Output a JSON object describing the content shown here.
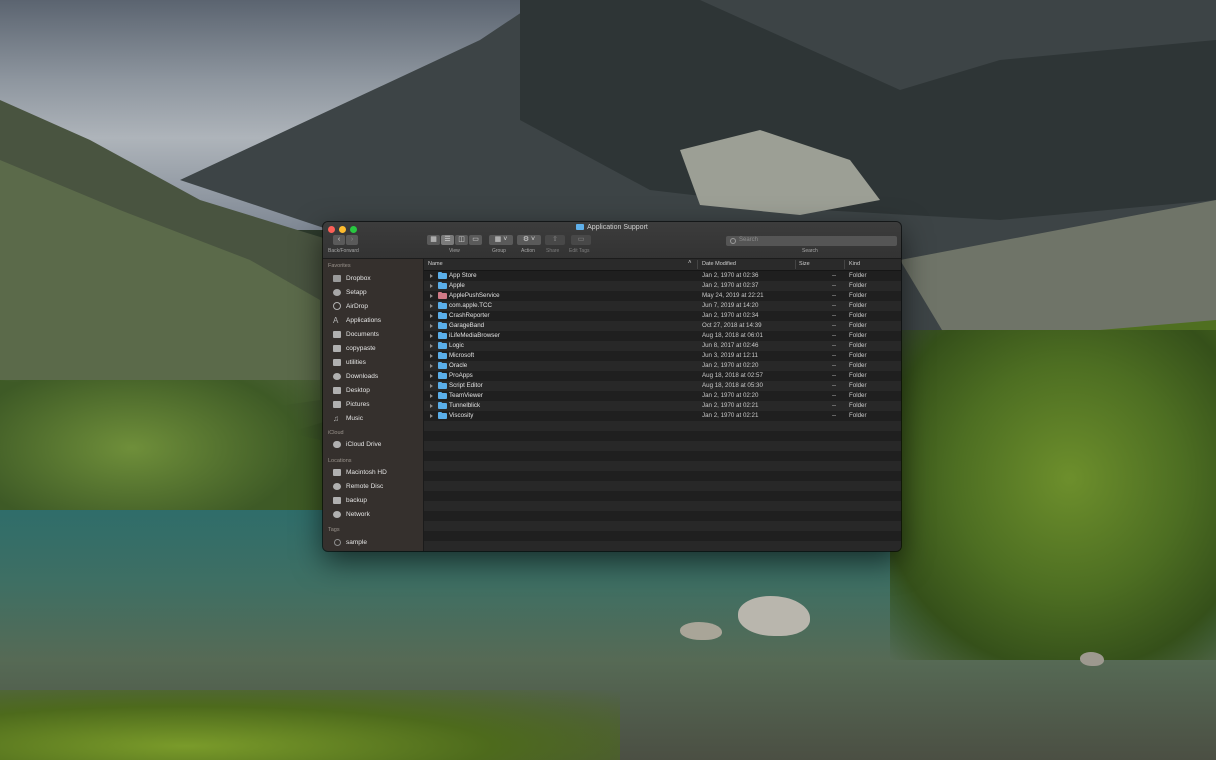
{
  "window": {
    "title": "Application Support",
    "traffic_colors": [
      "#fd5f57",
      "#febc2e",
      "#28c840"
    ]
  },
  "toolbar": {
    "back_forward_label": "Back/Forward",
    "view_label": "View",
    "group_label": "Group",
    "action_label": "Action",
    "share_label": "Share",
    "edit_tags_label": "Edit Tags",
    "search_label": "Search",
    "search_placeholder": "Search"
  },
  "sidebar": {
    "favorites_heading": "Favorites",
    "favorites": [
      {
        "label": "Dropbox",
        "icon": "dropbox-icon"
      },
      {
        "label": "Setapp",
        "icon": "setapp-icon"
      },
      {
        "label": "AirDrop",
        "icon": "airdrop-icon"
      },
      {
        "label": "Applications",
        "icon": "applications-icon"
      },
      {
        "label": "Documents",
        "icon": "documents-icon"
      },
      {
        "label": "copypaste",
        "icon": "folder-icon"
      },
      {
        "label": "utilities",
        "icon": "folder-icon"
      },
      {
        "label": "Downloads",
        "icon": "downloads-icon"
      },
      {
        "label": "Desktop",
        "icon": "desktop-icon"
      },
      {
        "label": "Pictures",
        "icon": "pictures-icon"
      },
      {
        "label": "Music",
        "icon": "music-icon"
      }
    ],
    "icloud_heading": "iCloud",
    "icloud": [
      {
        "label": "iCloud Drive",
        "icon": "icloud-icon"
      }
    ],
    "locations_heading": "Locations",
    "locations": [
      {
        "label": "Macintosh HD",
        "icon": "disk-icon"
      },
      {
        "label": "Remote Disc",
        "icon": "remote-disc-icon"
      },
      {
        "label": "backup",
        "icon": "disk-icon"
      },
      {
        "label": "Network",
        "icon": "network-icon"
      }
    ],
    "tags_heading": "Tags",
    "tags": [
      {
        "label": "sample",
        "icon": "tag-icon"
      }
    ]
  },
  "columns": {
    "name": "Name",
    "date": "Date Modified",
    "size": "Size",
    "kind": "Kind"
  },
  "files": [
    {
      "name": "App Store",
      "date": "Jan 2, 1970 at 02:36",
      "size": "--",
      "kind": "Folder"
    },
    {
      "name": "Apple",
      "date": "Jan 2, 1970 at 02:37",
      "size": "--",
      "kind": "Folder"
    },
    {
      "name": "ApplePushService",
      "date": "May 24, 2019 at 22:21",
      "size": "--",
      "kind": "Folder"
    },
    {
      "name": "com.apple.TCC",
      "date": "Jun 7, 2019 at 14:20",
      "size": "--",
      "kind": "Folder"
    },
    {
      "name": "CrashReporter",
      "date": "Jan 2, 1970 at 02:34",
      "size": "--",
      "kind": "Folder"
    },
    {
      "name": "GarageBand",
      "date": "Oct 27, 2018 at 14:39",
      "size": "--",
      "kind": "Folder"
    },
    {
      "name": "iLifeMediaBrowser",
      "date": "Aug 18, 2018 at 06:01",
      "size": "--",
      "kind": "Folder"
    },
    {
      "name": "Logic",
      "date": "Jun 8, 2017 at 02:46",
      "size": "--",
      "kind": "Folder"
    },
    {
      "name": "Microsoft",
      "date": "Jun 3, 2019 at 12:11",
      "size": "--",
      "kind": "Folder"
    },
    {
      "name": "Oracle",
      "date": "Jan 2, 1970 at 02:20",
      "size": "--",
      "kind": "Folder"
    },
    {
      "name": "ProApps",
      "date": "Aug 18, 2018 at 02:57",
      "size": "--",
      "kind": "Folder"
    },
    {
      "name": "Script Editor",
      "date": "Aug 18, 2018 at 05:30",
      "size": "--",
      "kind": "Folder"
    },
    {
      "name": "TeamViewer",
      "date": "Jan 2, 1970 at 02:20",
      "size": "--",
      "kind": "Folder"
    },
    {
      "name": "Tunnelblick",
      "date": "Jan 2, 1970 at 02:21",
      "size": "--",
      "kind": "Folder"
    },
    {
      "name": "Viscosity",
      "date": "Jan 2, 1970 at 02:21",
      "size": "--",
      "kind": "Folder"
    }
  ]
}
